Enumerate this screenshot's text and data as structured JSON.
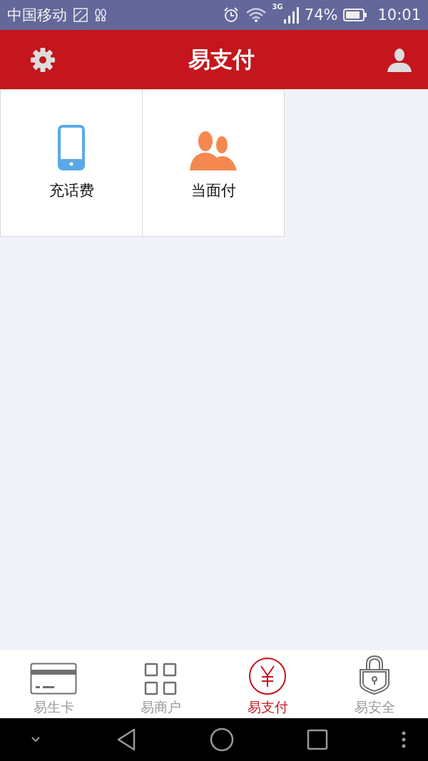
{
  "status_bar": {
    "carrier": "中国移动",
    "network": "3G",
    "battery": "74%",
    "time": "10:01"
  },
  "header": {
    "title": "易支付"
  },
  "tiles": [
    {
      "label": "充话费"
    },
    {
      "label": "当面付"
    }
  ],
  "tabs": [
    {
      "label": "易生卡",
      "selected": false
    },
    {
      "label": "易商户",
      "selected": false
    },
    {
      "label": "易支付",
      "selected": true
    },
    {
      "label": "易安全",
      "selected": false
    }
  ]
}
